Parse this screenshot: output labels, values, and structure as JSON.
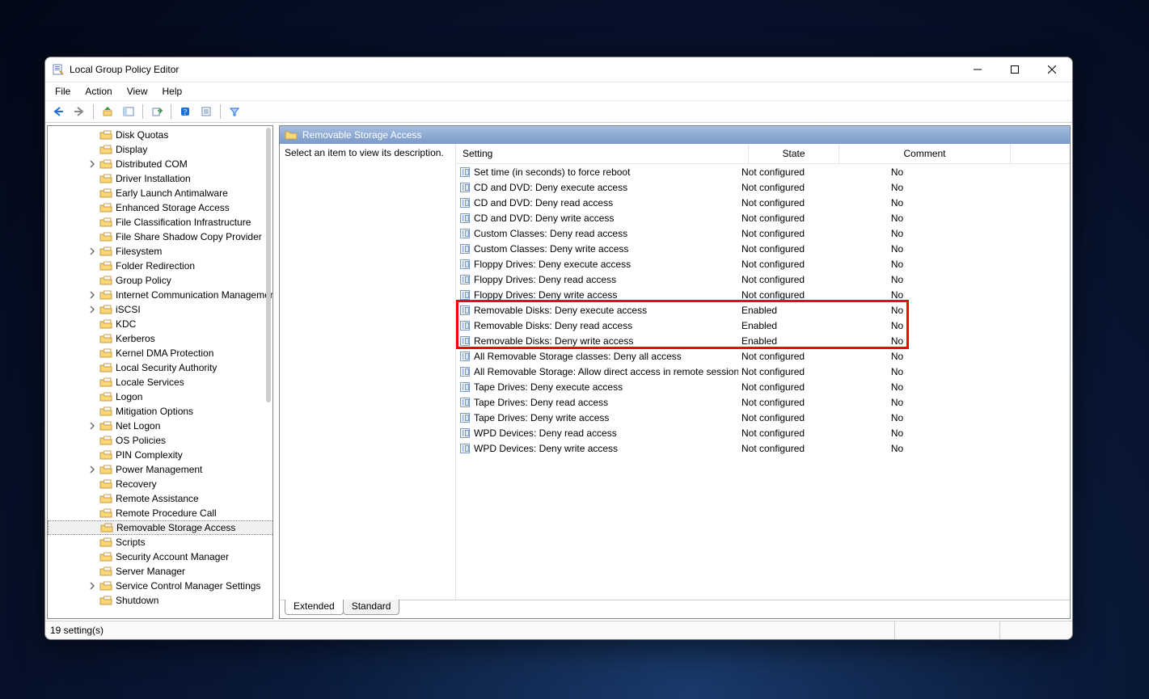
{
  "window": {
    "title": "Local Group Policy Editor",
    "tabs": {
      "extended": "Extended",
      "standard": "Standard"
    },
    "statusbar": "19 setting(s)",
    "win_controls": {
      "min": "−",
      "max": "□",
      "close": "✕"
    }
  },
  "menubar": [
    "File",
    "Action",
    "View",
    "Help"
  ],
  "right_header": "Removable Storage Access",
  "desc_text": "Select an item to view its description.",
  "list_headers": {
    "setting": "Setting",
    "state": "State",
    "comment": "Comment"
  },
  "tree": [
    {
      "label": "Disk Quotas",
      "indent": 5
    },
    {
      "label": "Display",
      "indent": 5
    },
    {
      "label": "Distributed COM",
      "indent": 5,
      "expander": true
    },
    {
      "label": "Driver Installation",
      "indent": 5
    },
    {
      "label": "Early Launch Antimalware",
      "indent": 5
    },
    {
      "label": "Enhanced Storage Access",
      "indent": 5
    },
    {
      "label": "File Classification Infrastructure",
      "indent": 5
    },
    {
      "label": "File Share Shadow Copy Provider",
      "indent": 5
    },
    {
      "label": "Filesystem",
      "indent": 5,
      "expander": true
    },
    {
      "label": "Folder Redirection",
      "indent": 5
    },
    {
      "label": "Group Policy",
      "indent": 5
    },
    {
      "label": "Internet Communication Management",
      "indent": 5,
      "expander": true
    },
    {
      "label": "iSCSI",
      "indent": 5,
      "expander": true
    },
    {
      "label": "KDC",
      "indent": 5
    },
    {
      "label": "Kerberos",
      "indent": 5
    },
    {
      "label": "Kernel DMA Protection",
      "indent": 5
    },
    {
      "label": "Local Security Authority",
      "indent": 5
    },
    {
      "label": "Locale Services",
      "indent": 5
    },
    {
      "label": "Logon",
      "indent": 5
    },
    {
      "label": "Mitigation Options",
      "indent": 5
    },
    {
      "label": "Net Logon",
      "indent": 5,
      "expander": true
    },
    {
      "label": "OS Policies",
      "indent": 5
    },
    {
      "label": "PIN Complexity",
      "indent": 5
    },
    {
      "label": "Power Management",
      "indent": 5,
      "expander": true
    },
    {
      "label": "Recovery",
      "indent": 5
    },
    {
      "label": "Remote Assistance",
      "indent": 5
    },
    {
      "label": "Remote Procedure Call",
      "indent": 5
    },
    {
      "label": "Removable Storage Access",
      "indent": 5,
      "selected": true
    },
    {
      "label": "Scripts",
      "indent": 5
    },
    {
      "label": "Security Account Manager",
      "indent": 5
    },
    {
      "label": "Server Manager",
      "indent": 5
    },
    {
      "label": "Service Control Manager Settings",
      "indent": 5,
      "expander": true
    },
    {
      "label": "Shutdown",
      "indent": 5
    }
  ],
  "settings": [
    {
      "name": "Set time (in seconds) to force reboot",
      "state": "Not configured",
      "comment": "No"
    },
    {
      "name": "CD and DVD: Deny execute access",
      "state": "Not configured",
      "comment": "No"
    },
    {
      "name": "CD and DVD: Deny read access",
      "state": "Not configured",
      "comment": "No"
    },
    {
      "name": "CD and DVD: Deny write access",
      "state": "Not configured",
      "comment": "No"
    },
    {
      "name": "Custom Classes: Deny read access",
      "state": "Not configured",
      "comment": "No"
    },
    {
      "name": "Custom Classes: Deny write access",
      "state": "Not configured",
      "comment": "No"
    },
    {
      "name": "Floppy Drives: Deny execute access",
      "state": "Not configured",
      "comment": "No"
    },
    {
      "name": "Floppy Drives: Deny read access",
      "state": "Not configured",
      "comment": "No"
    },
    {
      "name": "Floppy Drives: Deny write access",
      "state": "Not configured",
      "comment": "No"
    },
    {
      "name": "Removable Disks: Deny execute access",
      "state": "Enabled",
      "comment": "No"
    },
    {
      "name": "Removable Disks: Deny read access",
      "state": "Enabled",
      "comment": "No"
    },
    {
      "name": "Removable Disks: Deny write access",
      "state": "Enabled",
      "comment": "No"
    },
    {
      "name": "All Removable Storage classes: Deny all access",
      "state": "Not configured",
      "comment": "No"
    },
    {
      "name": "All Removable Storage: Allow direct access in remote sessions",
      "state": "Not configured",
      "comment": "No"
    },
    {
      "name": "Tape Drives: Deny execute access",
      "state": "Not configured",
      "comment": "No"
    },
    {
      "name": "Tape Drives: Deny read access",
      "state": "Not configured",
      "comment": "No"
    },
    {
      "name": "Tape Drives: Deny write access",
      "state": "Not configured",
      "comment": "No"
    },
    {
      "name": "WPD Devices: Deny read access",
      "state": "Not configured",
      "comment": "No"
    },
    {
      "name": "WPD Devices: Deny write access",
      "state": "Not configured",
      "comment": "No"
    }
  ],
  "highlight": {
    "start": 9,
    "end": 11
  }
}
